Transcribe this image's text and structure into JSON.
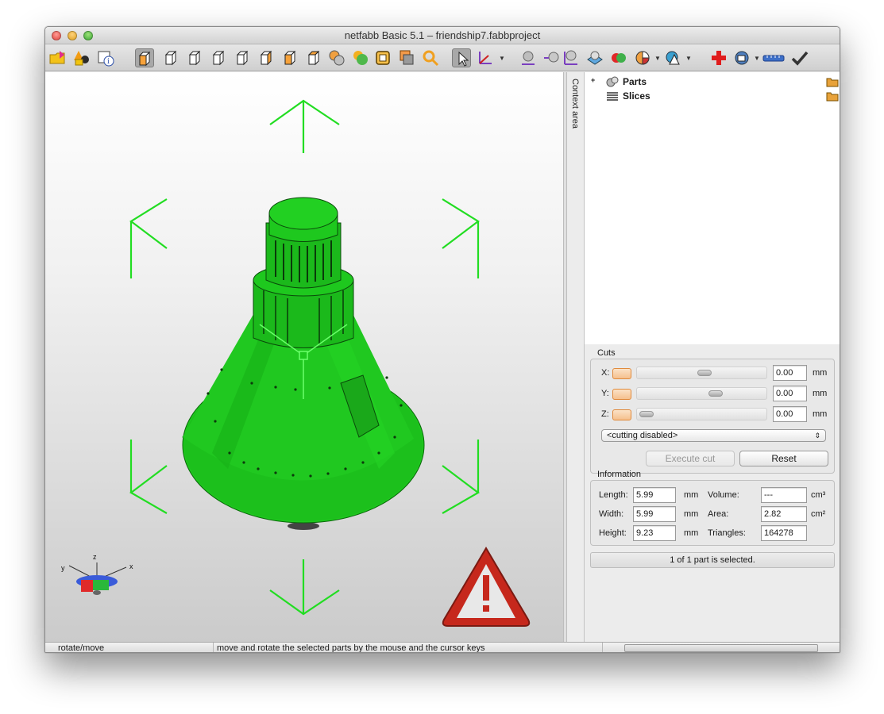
{
  "window": {
    "title": "netfabb Basic 5.1 – friendship7.fabbproject"
  },
  "toolbar": {
    "icons": [
      "open-project-icon",
      "add-part-icon",
      "part-info-icon",
      "view-perspective-icon",
      "view-front-icon",
      "view-back-icon",
      "view-left-icon",
      "view-right-icon",
      "view-top-icon",
      "view-bottom-icon",
      "shaded-icon",
      "solid-icon",
      "wireframe-icon",
      "transparent-icon",
      "zoom-icon",
      "select-pointer-icon",
      "axes-icon",
      "center-icon",
      "measure-icon",
      "split-icon",
      "slice-icon",
      "boolean-icon",
      "pie-icon",
      "triangles-icon",
      "repair-icon",
      "report-icon",
      "ruler-icon",
      "apply-icon"
    ]
  },
  "viewport": {
    "gizmo_labels": {
      "z": "z",
      "y": "y",
      "x": "x"
    },
    "colors": {
      "part": "#1ec81e",
      "arrows": "#22dd22",
      "warning": "#c6281c"
    }
  },
  "context": {
    "tab_label": "Context area",
    "tree": [
      {
        "label": "Parts",
        "expander": "+"
      },
      {
        "label": "Slices",
        "expander": ""
      }
    ]
  },
  "cuts": {
    "title": "Cuts",
    "rows": [
      {
        "axis": "X:",
        "value": "0.00",
        "unit": "mm"
      },
      {
        "axis": "Y:",
        "value": "0.00",
        "unit": "mm"
      },
      {
        "axis": "Z:",
        "value": "0.00",
        "unit": "mm"
      }
    ],
    "mode_select": "<cutting disabled>",
    "execute_label": "Execute cut",
    "reset_label": "Reset"
  },
  "information": {
    "title": "Information",
    "length": {
      "label": "Length:",
      "value": "5.99",
      "unit": "mm"
    },
    "width": {
      "label": "Width:",
      "value": "5.99",
      "unit": "mm"
    },
    "height": {
      "label": "Height:",
      "value": "9.23",
      "unit": "mm"
    },
    "volume": {
      "label": "Volume:",
      "value": "---",
      "unit": "cm³"
    },
    "area": {
      "label": "Area:",
      "value": "2.82",
      "unit": "cm²"
    },
    "triangles": {
      "label": "Triangles:",
      "value": "164278"
    }
  },
  "selection_status": "1 of 1 part is selected.",
  "statusbar": {
    "mode": "rotate/move",
    "hint": "move and rotate the selected parts by the mouse and the cursor keys"
  }
}
